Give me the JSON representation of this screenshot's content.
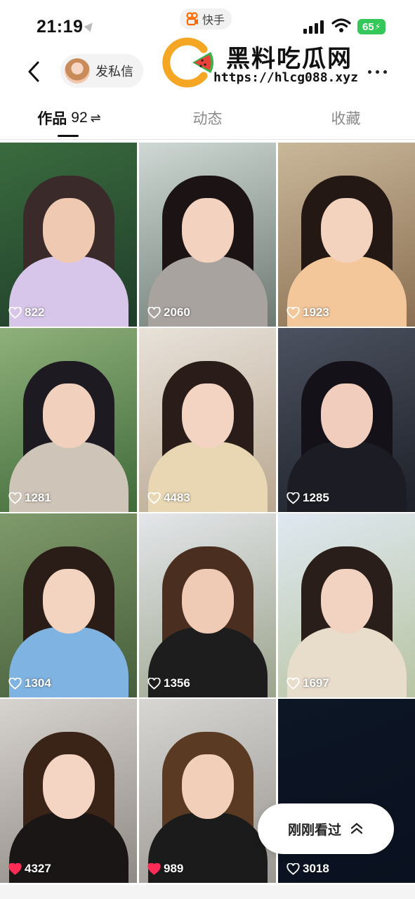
{
  "status_bar": {
    "time": "21:19",
    "app_name": "快手",
    "battery": "65"
  },
  "header": {
    "dm_label": "发私信",
    "back_icon": "chevron-left-icon",
    "more_icon": "more-dots-icon"
  },
  "watermark": {
    "title": "黑料吃瓜网",
    "url": "https://hlcg088.xyz"
  },
  "tabs": [
    {
      "label": "作品",
      "count": "92",
      "suffix": "⇌",
      "active": true
    },
    {
      "label": "动态",
      "active": false
    },
    {
      "label": "收藏",
      "active": false
    }
  ],
  "grid": {
    "items": [
      {
        "likes": "822",
        "liked": false
      },
      {
        "likes": "2060",
        "liked": false
      },
      {
        "likes": "1923",
        "liked": false
      },
      {
        "likes": "1281",
        "liked": false
      },
      {
        "likes": "4483",
        "liked": false
      },
      {
        "likes": "1285",
        "liked": false
      },
      {
        "likes": "1304",
        "liked": false
      },
      {
        "likes": "1356",
        "liked": false
      },
      {
        "likes": "1697",
        "liked": false
      },
      {
        "likes": "4327",
        "liked": true
      },
      {
        "likes": "989",
        "liked": true
      },
      {
        "likes": "3018",
        "liked": false
      }
    ]
  },
  "recent_pill": {
    "label": "刚刚看过"
  },
  "colors": {
    "liked_heart": "#ff2d55",
    "battery": "#34c759",
    "watermark_orange": "#f5a623",
    "watermark_green": "#3bb54a"
  }
}
